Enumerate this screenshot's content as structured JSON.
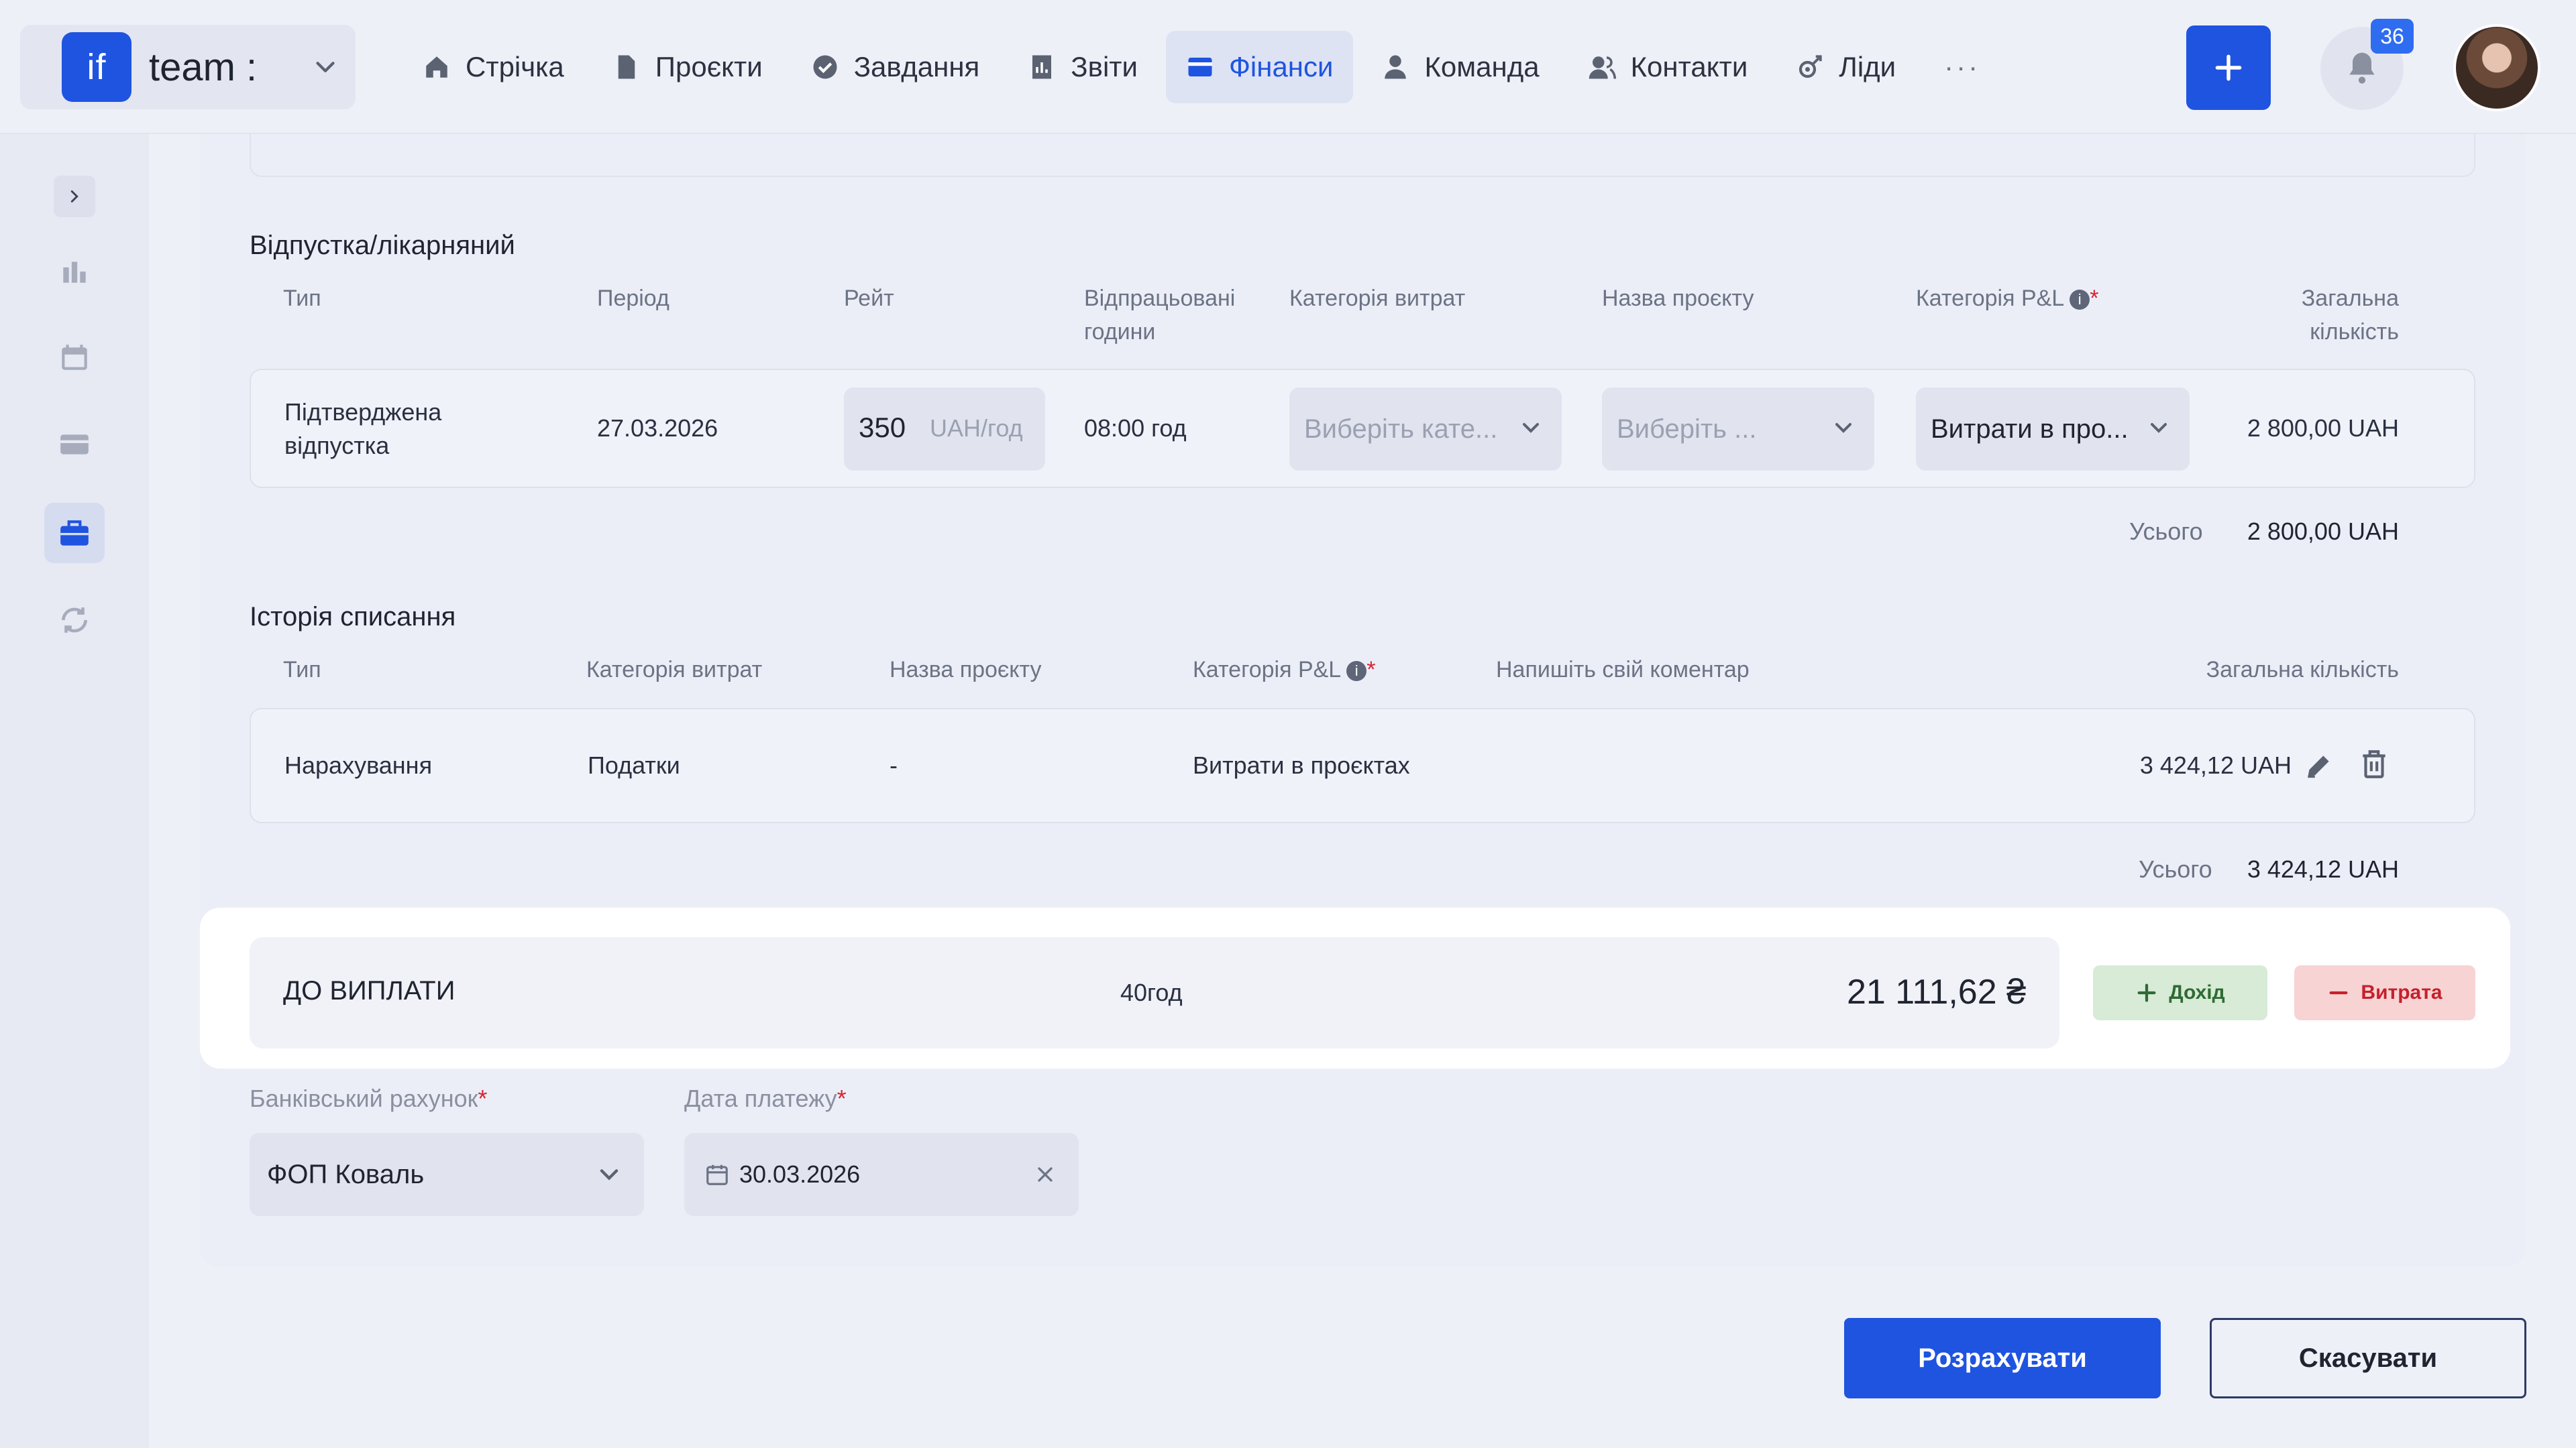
{
  "app": {
    "team_name": "team :",
    "logo_text": "if",
    "notifications_count": "36"
  },
  "nav": [
    {
      "label": "Стрічка",
      "icon": "home-icon"
    },
    {
      "label": "Проєкти",
      "icon": "file-icon"
    },
    {
      "label": "Завдання",
      "icon": "check-circle-icon"
    },
    {
      "label": "Звіти",
      "icon": "report-icon"
    },
    {
      "label": "Фінанси",
      "icon": "wallet-icon",
      "active": true
    },
    {
      "label": "Команда",
      "icon": "user-icon"
    },
    {
      "label": "Контакти",
      "icon": "contacts-icon"
    },
    {
      "label": "Ліди",
      "icon": "leads-icon"
    }
  ],
  "nav_more": "···",
  "sidebar": {
    "items": [
      "chart-icon",
      "calendar-icon",
      "card-icon",
      "briefcase-icon",
      "refresh-icon"
    ],
    "active_index": 3
  },
  "vacation": {
    "title": "Відпустка/лікарняний",
    "headers": {
      "type": "Тип",
      "period": "Період",
      "rate": "Рейт",
      "hours_line1": "Відпрацьовані",
      "hours_line2": "години",
      "expense_category": "Категорія витрат",
      "project_name": "Назва проєкту",
      "pl_category": "Категорія P&L",
      "total_line1": "Загальна",
      "total_line2": "кількість"
    },
    "row": {
      "type_line1": "Підтверджена",
      "type_line2": "відпустка",
      "period": "27.03.2026",
      "rate_value": "350",
      "rate_unit": "UAH/год",
      "hours": "08:00 год",
      "expense_category_placeholder": "Виберіть кате...",
      "project_placeholder": "Виберіть ...",
      "pl_category_value": "Витрати в про...",
      "total": "2 800,00 UAH"
    },
    "sum_label": "Усього",
    "sum_value": "2 800,00 UAH"
  },
  "writeoffs": {
    "title": "Історія списання",
    "headers": {
      "type": "Тип",
      "expense_category": "Категорія витрат",
      "project_name": "Назва проєкту",
      "pl_category": "Категорія P&L",
      "comment": "Напишіть свій коментар",
      "total": "Загальна кількість"
    },
    "row": {
      "type": "Нарахування",
      "expense_category": "Податки",
      "project_name": "-",
      "pl_category": "Витрати в проєктах",
      "total": "3 424,12 UAH"
    },
    "sum_label": "Усього",
    "sum_value": "3 424,12 UAH"
  },
  "payout": {
    "label": "ДО ВИПЛАТИ",
    "hours": "40год",
    "amount": "21 111,62 ₴",
    "income_button": "Дохід",
    "expense_button": "Витрата"
  },
  "payment": {
    "bank_account_label": "Банківський рахунок",
    "bank_account_value": "ФОП Коваль",
    "date_label": "Дата платежу",
    "date_value": "30.03.2026"
  },
  "actions": {
    "calculate": "Розрахувати",
    "cancel": "Скасувати"
  },
  "colors": {
    "accent": "#1f54e0",
    "income_bg": "#d7ebd6",
    "expense_bg": "#f8d3d4",
    "required": "#d9232f"
  }
}
